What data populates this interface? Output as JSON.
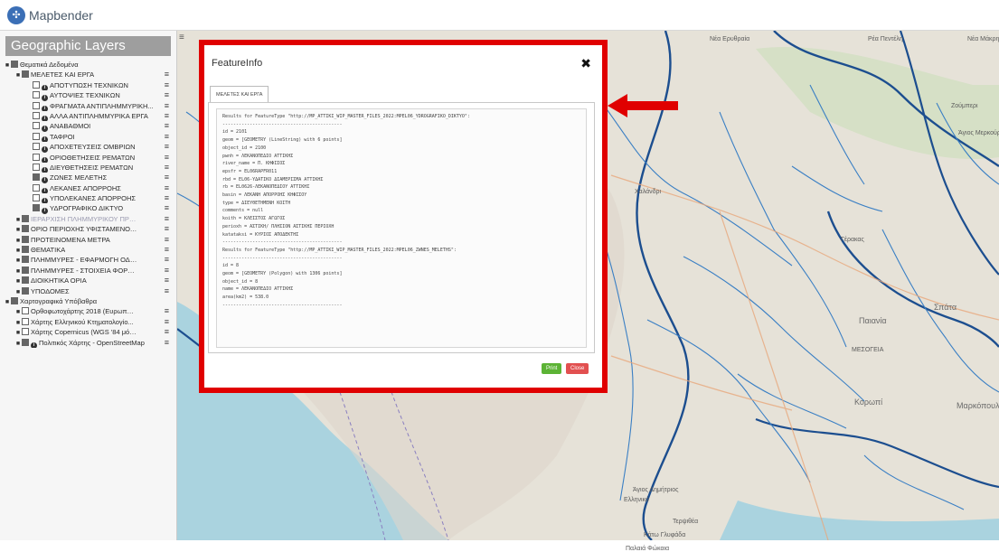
{
  "app": {
    "title": "Mapbender",
    "logo_glyph": "✣"
  },
  "sidebar": {
    "title": "Geographic Layers",
    "toggle_glyph": "≡",
    "items": [
      {
        "label": "Θεματικά Δεδομένα",
        "level": 0,
        "checked": true,
        "info": false,
        "menu": false,
        "dim": false
      },
      {
        "label": "ΜΕΛΕΤΕΣ ΚΑΙ ΕΡΓΑ",
        "level": 1,
        "checked": true,
        "info": false,
        "menu": true,
        "dim": false
      },
      {
        "label": "ΑΠΟΤΥΠΩΣΗ ΤΕΧΝΙΚΩΝ",
        "level": 2,
        "checked": false,
        "info": true,
        "menu": true,
        "dim": false
      },
      {
        "label": "ΑΥΤΟΨΙΕΣ ΤΕΧΝΙΚΩΝ",
        "level": 2,
        "checked": false,
        "info": true,
        "menu": true,
        "dim": false
      },
      {
        "label": "ΦΡΑΓΜΑΤΑ ΑΝΤΙΠΛΗΜΜΥΡΙΚΗ...",
        "level": 2,
        "checked": false,
        "info": true,
        "menu": true,
        "dim": false
      },
      {
        "label": "ΑΛΛΑ ΑΝΤΙΠΛΗΜΜΥΡΙΚΑ ΕΡΓΑ",
        "level": 2,
        "checked": false,
        "info": true,
        "menu": true,
        "dim": false
      },
      {
        "label": "ΑΝΑΒΑΘΜΟΙ",
        "level": 2,
        "checked": false,
        "info": true,
        "menu": true,
        "dim": false
      },
      {
        "label": "ΤΑΦΡΟΙ",
        "level": 2,
        "checked": false,
        "info": true,
        "menu": true,
        "dim": false
      },
      {
        "label": "ΑΠΟΧΕΤΕΥΣΕΙΣ ΟΜΒΡΙΩΝ",
        "level": 2,
        "checked": false,
        "info": true,
        "menu": true,
        "dim": false
      },
      {
        "label": "ΟΡΙΟΘΕΤΗΣΕΙΣ ΡΕΜΑΤΩΝ",
        "level": 2,
        "checked": false,
        "info": true,
        "menu": true,
        "dim": false
      },
      {
        "label": "ΔΙΕΥΘΕΤΗΣΕΙΣ ΡΕΜΑΤΩΝ",
        "level": 2,
        "checked": false,
        "info": true,
        "menu": true,
        "dim": false
      },
      {
        "label": "ΖΩΝΕΣ ΜΕΛΕΤΗΣ",
        "level": 2,
        "checked": true,
        "info": true,
        "menu": true,
        "dim": false
      },
      {
        "label": "ΛΕΚΑΝΕΣ ΑΠΟΡΡΟΗΣ",
        "level": 2,
        "checked": false,
        "info": true,
        "menu": true,
        "dim": false
      },
      {
        "label": "ΥΠΟΛΕΚΑΝΕΣ ΑΠΟΡΡΟΗΣ",
        "level": 2,
        "checked": false,
        "info": true,
        "menu": true,
        "dim": false
      },
      {
        "label": "ΥΔΡΟΓΡΑΦΙΚΟ ΔΙΚΤΥΟ",
        "level": 2,
        "checked": true,
        "info": true,
        "menu": true,
        "dim": false
      },
      {
        "label": "ΙΕΡΑΡΧΙΣΗ ΠΛΗΜΜΥΡΙΚΟΥ ΠΡΟΒ...",
        "level": 1,
        "checked": true,
        "info": false,
        "menu": true,
        "dim": true
      },
      {
        "label": "ΟΡΙΟ ΠΕΡΙΟΧΗΣ ΥΦΙΣΤΑΜΕΝΟΥ ...",
        "level": 1,
        "checked": true,
        "info": false,
        "menu": true,
        "dim": false
      },
      {
        "label": "ΠΡΟΤΕΙΝΟΜΕΝΑ ΜΕΤΡΑ",
        "level": 1,
        "checked": true,
        "info": false,
        "menu": true,
        "dim": false
      },
      {
        "label": "ΘΕΜΑΤΙΚΑ",
        "level": 1,
        "checked": true,
        "info": false,
        "menu": true,
        "dim": false
      },
      {
        "label": "ΠΛΗΜΜΥΡΕΣ - ΕΦΑΡΜΟΓΗ ΟΔΗΓΙ...",
        "level": 1,
        "checked": true,
        "info": false,
        "menu": true,
        "dim": false
      },
      {
        "label": "ΠΛΗΜΜΥΡΕΣ - ΣΤΟΙΧΕΙΑ ΦΟΡΕΩΝ",
        "level": 1,
        "checked": true,
        "info": false,
        "menu": true,
        "dim": false
      },
      {
        "label": "ΔΙΟΙΚΗΤΙΚΑ ΟΡΙΑ",
        "level": 1,
        "checked": true,
        "info": false,
        "menu": true,
        "dim": false
      },
      {
        "label": "ΥΠΟΔΟΜΕΣ",
        "level": 1,
        "checked": true,
        "info": false,
        "menu": true,
        "dim": false
      },
      {
        "label": "Χαρτογραφικά Υπόβαθρα",
        "level": 0,
        "checked": true,
        "info": false,
        "menu": false,
        "dim": false
      },
      {
        "label": "Ορθοφωτοχάρτης 2018 (Ευρωπαϊ...",
        "level": 1,
        "checked": false,
        "info": false,
        "menu": true,
        "dim": false
      },
      {
        "label": "Χάρτης Ελληνικού Κτηματολογίο...",
        "level": 1,
        "checked": false,
        "info": false,
        "menu": true,
        "dim": false
      },
      {
        "label": "Χάρτης Copernicus (WGS '84 μόν...",
        "level": 1,
        "checked": false,
        "info": false,
        "menu": true,
        "dim": false
      },
      {
        "label": "Πολιτικός Χάρτης - OpenStreetMap",
        "level": 1,
        "checked": true,
        "info": true,
        "menu": true,
        "dim": false
      }
    ]
  },
  "dialog": {
    "title": "FeatureInfo",
    "close_glyph": "✖",
    "tab_label": "ΜΕΛΕΤΕΣ ΚΑΙ ΕΡΓΑ",
    "content": "Results for FeatureType \"http://MP_ATTIKI_WIP_MASTER_FILES_2022:MPEL06_YDROGRAFIKO_DIKTYO\":\n--------------------------------------------\nid = 2101\ngeom = [GEOMETRY (LineString) with 6 points]\nobject_id = 2100\npwnh = ΛΕΚΑΝΟΠΕΔΙΟ ΑΤΤΙΚΗΣ\nriver_name = Π. ΚΗΦΙΣΟΣ\nepsfr = EL06RAPFR011\nrbd = EL06-ΥΔΑΤΙΚΟ ΔΙΑΜΕΡΙΣΜΑ ΑΤΤΙΚΗΣ\nrb = EL0626-ΛΕΚΑΝΟΠΕΔΙΟΥ ΑΤΤΙΚΗΣ\nbasin = ΛΕΚΑΝΗ ΑΠΟΡΡΟΗΣ ΚΗΦΙΣΟΥ\ntype = ΔΙΕΥΘΕΤΗΜΕΝΗ ΚΟΙΤΗ\ncomments = null\nkoith = ΚΛΕΙΣΤΟΣ ΑΓΩΓΟΣ\nperioxh = ΑΣΤΙΚΗ/ ΠΛΗΣΙΟΝ ΑΣΤΙΚΗΣ ΠΕΡΙΟΧΗ\nkatataksi = ΚΥΡΙΟΣ ΑΠΟΔΕΚΤΗΣ\n--------------------------------------------\nResults for FeatureType \"http://MP_ATTIKI_WIP_MASTER_FILES_2022:MPEL06_ZWNES_MELETHS\":\n--------------------------------------------\nid = 8\ngeom = [GEOMETRY (Polygon) with 1306 points]\nobject_id = 8\nname = ΛΕΚΑΝΟΠΕΔΙΟ ΑΤΤΙΚΗΣ\narea(km2) = 538.0\n--------------------------------------------",
    "print_label": "Print",
    "close_label": "Close"
  },
  "map": {
    "places": [
      {
        "name": "Νέα Ερυθραία",
        "cls": ""
      },
      {
        "name": "Ρέα Πεντέλη",
        "cls": ""
      },
      {
        "name": "Νέα Μάκρη",
        "cls": ""
      },
      {
        "name": "Ζούμπερι",
        "cls": ""
      },
      {
        "name": "Άγιος Μερκούριος",
        "cls": ""
      },
      {
        "name": "Χαλάνδρι",
        "cls": ""
      },
      {
        "name": "Γέρακας",
        "cls": ""
      },
      {
        "name": "Σπάτα",
        "cls": "big"
      },
      {
        "name": "Παιανία",
        "cls": "big"
      },
      {
        "name": "ΜΕΣΟΓΕΙΑ",
        "cls": ""
      },
      {
        "name": "Κορωπί",
        "cls": "big"
      },
      {
        "name": "Μαρκόπουλο",
        "cls": "big"
      },
      {
        "name": "Άγιος Δημήτριος",
        "cls": ""
      },
      {
        "name": "Ελληνικό",
        "cls": ""
      },
      {
        "name": "Τερψιθέα",
        "cls": ""
      },
      {
        "name": "Κάτω Γλυφάδα",
        "cls": ""
      },
      {
        "name": "Παλαιά Φώκαια",
        "cls": ""
      }
    ]
  },
  "colors": {
    "highlight": "#e00000",
    "river": "#3a7fc4",
    "boundary": "#1c4e8f",
    "sea": "#aad3df",
    "print": "#5cb335",
    "close": "#e25050"
  }
}
